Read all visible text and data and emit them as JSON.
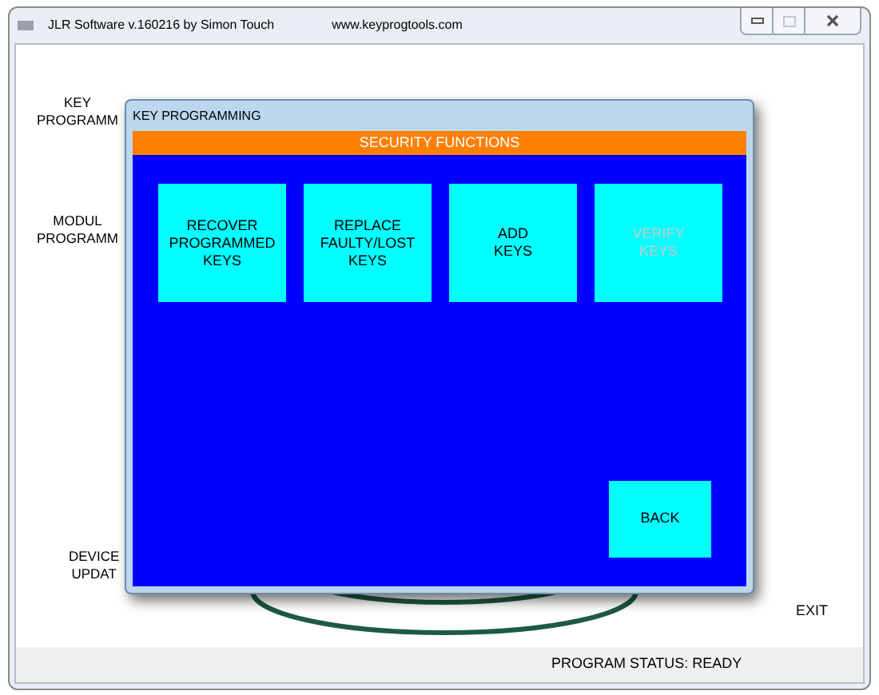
{
  "window": {
    "title": "JLR Software v.160216 by Simon Touch",
    "website": "www.keyprogtools.com",
    "controls": [
      {
        "kind": "minimize",
        "disabled": false
      },
      {
        "kind": "maximize",
        "disabled": true
      },
      {
        "kind": "close",
        "disabled": false
      }
    ]
  },
  "menu": [
    {
      "lines": [
        "KEY",
        "PROGRAMM"
      ]
    },
    {
      "lines": [
        "MODUL",
        "PROGRAMM"
      ]
    },
    {
      "lines": [
        "DEVICE",
        "UPDAT"
      ]
    }
  ],
  "exit_button": "EXIT",
  "status_bar": "PROGRAM STATUS: READY",
  "dialog": {
    "title": "KEY PROGRAMMING",
    "header": "SECURITY FUNCTIONS",
    "buttons": [
      {
        "lines": [
          "RECOVER",
          "PROGRAMMED",
          "KEYS"
        ],
        "disabled": false
      },
      {
        "lines": [
          "REPLACE",
          "FAULTY/LOST",
          "KEYS"
        ],
        "disabled": false
      },
      {
        "lines": [
          "ADD",
          "KEYS"
        ],
        "disabled": false
      },
      {
        "lines": [
          "VERIFY",
          "KEYS"
        ],
        "disabled": true
      }
    ],
    "back_button": "BACK"
  }
}
